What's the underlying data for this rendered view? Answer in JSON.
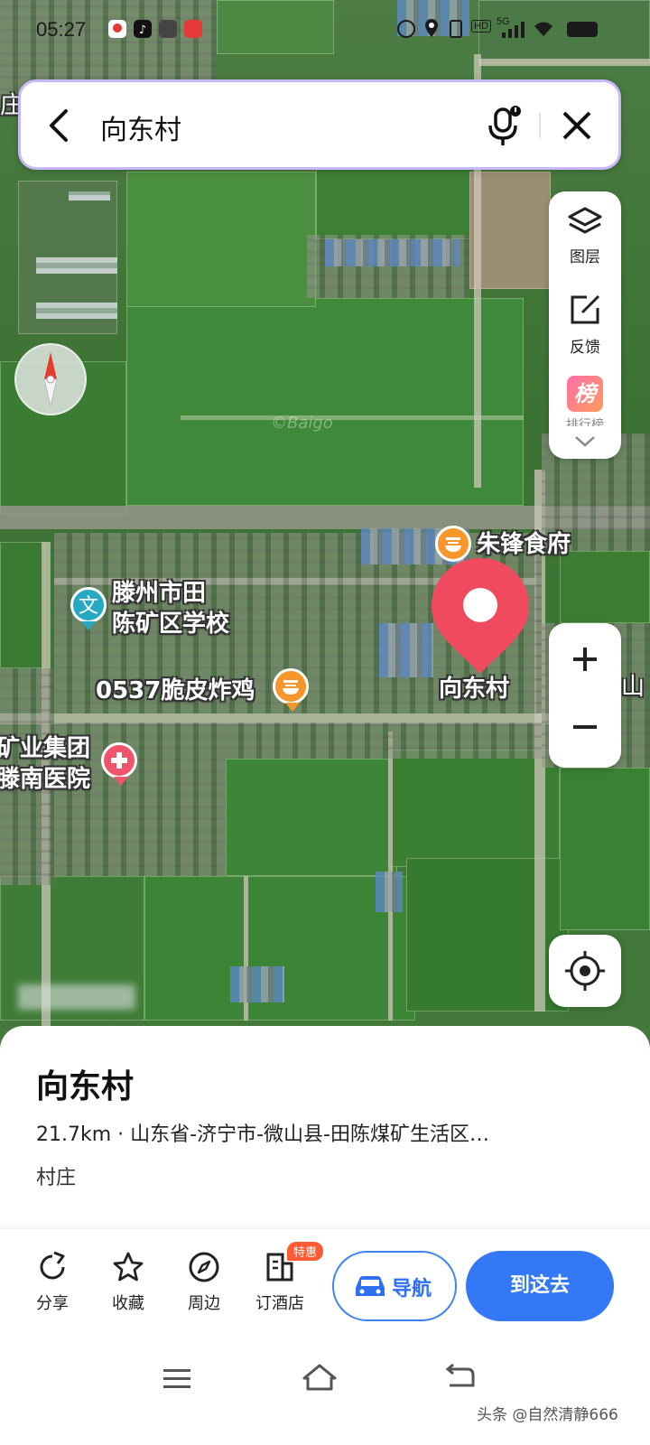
{
  "status_bar": {
    "time": "05:27",
    "network": "5G",
    "hd": "HD"
  },
  "search": {
    "query": "向东村"
  },
  "map": {
    "watermark": "©Baigo",
    "toolbar": {
      "layers_label": "图层",
      "feedback_label": "反馈",
      "rank_icon": "榜",
      "rank_label": "排行榜"
    },
    "labels": {
      "restaurant": "朱锋食府",
      "school_line1": "滕州市田",
      "school_line2": "陈矿区学校",
      "chicken": "0537脆皮炸鸡",
      "selected_place": "向东村",
      "hospital_line1": "矿业集团",
      "hospital_line2": "滕南医院",
      "edge_char": "庄",
      "edge_char_right": "山"
    },
    "colors": {
      "marker": "#f04a5e",
      "poi_food": "#f7962b",
      "poi_school": "#27a9c4",
      "poi_hospital": "#f0546a"
    }
  },
  "place": {
    "name": "向东村",
    "detail": "21.7km · 山东省-济宁市-微山县-田陈煤矿生活区…",
    "type": "村庄"
  },
  "actions": {
    "share": "分享",
    "favorite": "收藏",
    "nearby": "周边",
    "hotel": "订酒店",
    "hotel_badge": "特惠",
    "navigate": "导航",
    "go_here": "到这去"
  },
  "footer": {
    "watermark": "头条 @自然清静666"
  },
  "accent": "#3478f6"
}
